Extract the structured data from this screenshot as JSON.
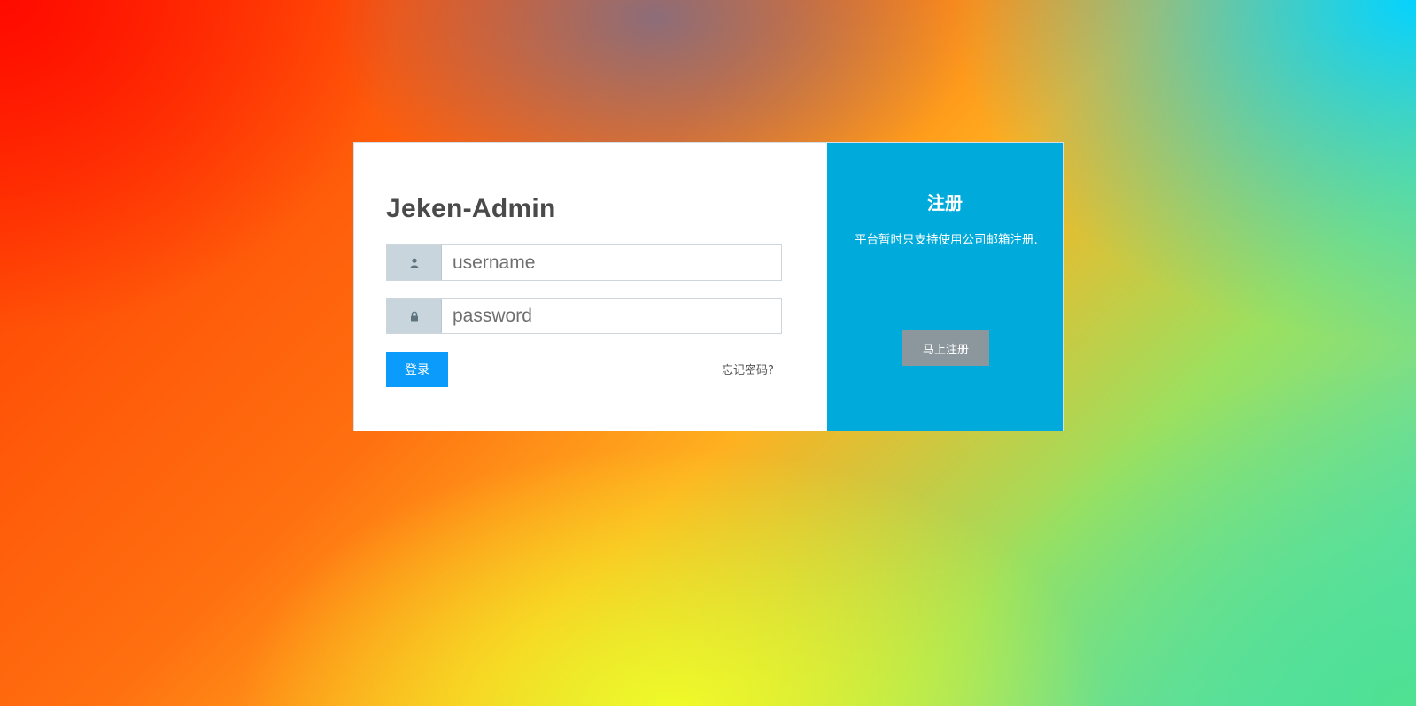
{
  "colors": {
    "primary_button": "#0b9bfa",
    "register_panel": "#00abdb",
    "register_button": "#8c969d",
    "input_addon": "#c8d5dc"
  },
  "login": {
    "title": "Jeken-Admin",
    "username": {
      "icon": "user-icon",
      "placeholder": "username",
      "value": ""
    },
    "password": {
      "icon": "lock-icon",
      "placeholder": "password",
      "value": ""
    },
    "submit_label": "登录",
    "forgot_label": "忘记密码?"
  },
  "register": {
    "title": "注册",
    "description": "平台暂时只支持使用公司邮箱注册.",
    "button_label": "马上注册"
  }
}
